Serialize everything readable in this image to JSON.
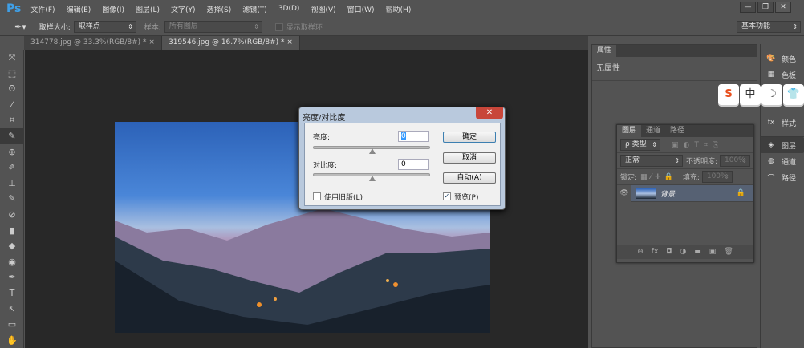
{
  "app": {
    "logo": "Ps",
    "menus": [
      "文件(F)",
      "编辑(E)",
      "图像(I)",
      "图层(L)",
      "文字(Y)",
      "选择(S)",
      "滤镜(T)",
      "3D(D)",
      "视图(V)",
      "窗口(W)",
      "帮助(H)"
    ],
    "window_buttons": [
      "—",
      "❐",
      "✕"
    ]
  },
  "options": {
    "sample_size_label": "取样大小:",
    "sample_size_value": "取样点",
    "sample_label": "样本:",
    "sample_value": "所有图层",
    "show_ring": "显示取样环",
    "workspace": "基本功能"
  },
  "tabs": [
    {
      "label": "314778.jpg @ 33.3%(RGB/8#) *",
      "close": "×"
    },
    {
      "label": "319546.jpg @ 16.7%(RGB/8#) *",
      "close": "×"
    }
  ],
  "tools": [
    "⤧",
    "⬚",
    "ʘ",
    "⁄",
    "⌗",
    "✎",
    "⊕",
    "✐",
    "⊥",
    "✎",
    "⊘",
    "▮",
    "◆",
    "◉",
    "✒",
    "T",
    "↖",
    "▭",
    "✋"
  ],
  "dialog": {
    "title": "亮度/对比度",
    "close": "✕",
    "brightness_label": "亮度:",
    "brightness_value": "0",
    "contrast_label": "对比度:",
    "contrast_value": "0",
    "ok": "确定",
    "cancel": "取消",
    "auto": "自动(A)",
    "legacy": "使用旧版(L)",
    "legacy_checked": false,
    "preview": "预览(P)",
    "preview_checked": true
  },
  "properties": {
    "tab": "属性",
    "content": "无属性"
  },
  "layers": {
    "tabs": [
      "图层",
      "通道",
      "路径"
    ],
    "filter": "ρ 类型",
    "blend": "正常",
    "opacity_label": "不透明度:",
    "opacity": "100%",
    "lock_label": "锁定:",
    "fill_label": "填充:",
    "fill": "100%",
    "layer_name": "背景",
    "footer_icons": [
      "⊖",
      "fx",
      "◘",
      "◑",
      "▬",
      "▣",
      "🗑"
    ]
  },
  "dock": [
    {
      "icon": "🎨",
      "label": "颜色"
    },
    {
      "icon": "▦",
      "label": "色板"
    },
    {
      "icon": "fx",
      "label": "样式"
    },
    {
      "icon": "◈",
      "label": "图层"
    },
    {
      "icon": "◍",
      "label": "通道"
    },
    {
      "icon": "⌒",
      "label": "路径"
    }
  ],
  "ime": [
    "S",
    "中",
    "☽",
    "👕"
  ]
}
